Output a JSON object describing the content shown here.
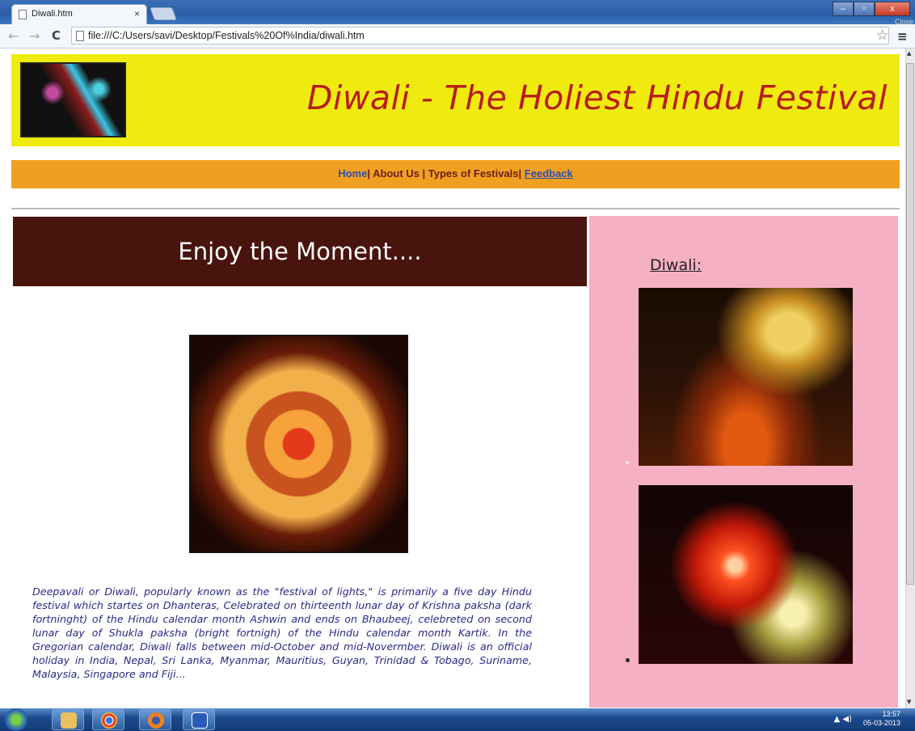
{
  "browser": {
    "tab_title": "Diwali.htm",
    "tab_close": "×",
    "url": "file:///C:/Users/savi/Desktop/Festivals%20Of%India/diwali.htm",
    "close_tooltip": "Close",
    "back": "←",
    "forward": "→",
    "reload": "C",
    "star": "☆",
    "menu": "≡",
    "win_min": "–",
    "win_max": "▫",
    "win_close": "x"
  },
  "header": {
    "title": "Diwali - The Holiest Hindu Festival"
  },
  "nav": {
    "home": "Home",
    "about": "About Us",
    "types": "Types of Festivals",
    "feedback": "Feedback",
    "sep": "|"
  },
  "main": {
    "banner": "Enjoy the Moment....",
    "paragraph": "Deepavali or Diwali, popularly known as the \"festival of lights,\" is primarily a five day Hindu festival which startes on Dhanteras, Celebrated on thirteenth lunar day of Krishna paksha (dark fortninght) of the Hindu calendar month Ashwin and ends on Bhaubeej, celebreted on second lunar day of Shukla paksha (bright fortnigh) of the Hindu calendar month Kartik. In the Gregorian calendar, Diwali falls between mid-October and mid-Novermber. Diwali is an official holiday in India, Nepal, Sri Lanka, Myanmar, Mauritius, Guyan, Trinidad & Tobago, Suriname, Malaysia, Singapore and Fiji..."
  },
  "sidebar": {
    "title": "Diwali:"
  },
  "taskbar": {
    "time": "13:57",
    "date": "05-03-2013",
    "tray": "▲ ◀)"
  }
}
